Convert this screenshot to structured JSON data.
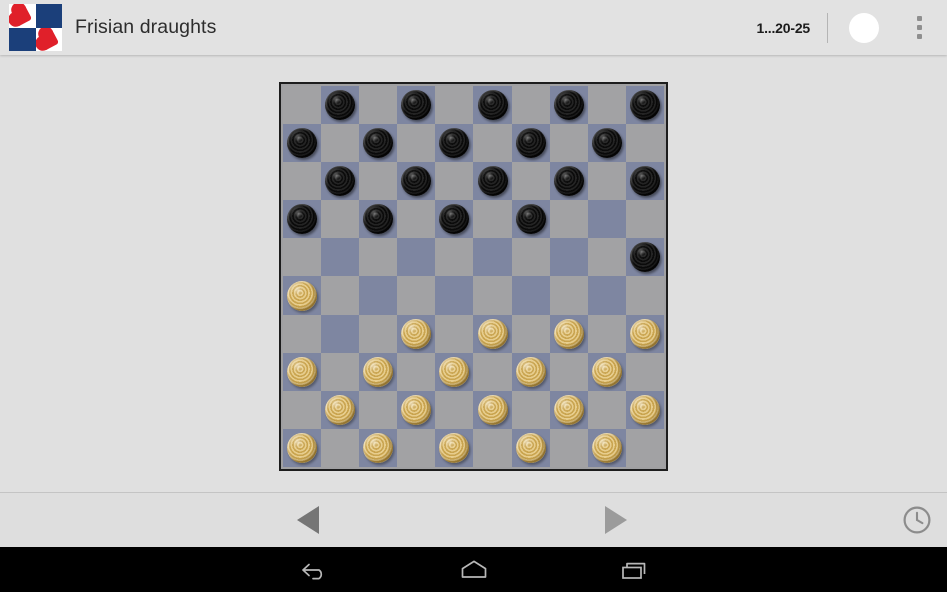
{
  "app": {
    "title": "Frisian draughts",
    "logo": {
      "name": "frisian-draughts-logo",
      "colors": {
        "blue": "#1b3f7a",
        "red": "#e0202a",
        "white": "#ffffff"
      }
    },
    "background_color": "#e0e0e0"
  },
  "appbar": {
    "move_indicator": "1...20-25",
    "turn_indicator": {
      "name": "turn-indicator-white",
      "color": "#ffffff"
    },
    "overflow_menu_label": "More options"
  },
  "board": {
    "size": 10,
    "light_square_color": "#a2a2a4",
    "dark_square_color": "#7e86a1",
    "border_color": "#1d1d1d",
    "black_piece_color": "#111111",
    "gold_piece_color": "#d6b264",
    "rows": [
      [
        null,
        "black",
        null,
        "black",
        null,
        "black",
        null,
        "black",
        null,
        "black"
      ],
      [
        "black",
        null,
        "black",
        null,
        "black",
        null,
        "black",
        null,
        "black",
        null
      ],
      [
        null,
        "black",
        null,
        "black",
        null,
        "black",
        null,
        "black",
        null,
        "black"
      ],
      [
        "black",
        null,
        "black",
        null,
        "black",
        null,
        "black",
        null,
        null,
        null
      ],
      [
        null,
        null,
        null,
        null,
        null,
        null,
        null,
        null,
        null,
        "black"
      ],
      [
        "gold",
        null,
        null,
        null,
        null,
        null,
        null,
        null,
        null,
        null
      ],
      [
        null,
        null,
        null,
        "gold",
        null,
        "gold",
        null,
        "gold",
        null,
        "gold"
      ],
      [
        "gold",
        null,
        "gold",
        null,
        "gold",
        null,
        "gold",
        null,
        "gold",
        null
      ],
      [
        null,
        "gold",
        null,
        "gold",
        null,
        "gold",
        null,
        "gold",
        null,
        "gold"
      ],
      [
        "gold",
        null,
        "gold",
        null,
        "gold",
        null,
        "gold",
        null,
        "gold",
        null
      ]
    ]
  },
  "controlbar": {
    "prev_label": "Previous move",
    "next_label": "Next move",
    "clock_label": "Clock"
  },
  "androidnav": {
    "back_label": "Back",
    "home_label": "Home",
    "recents_label": "Recent apps"
  }
}
